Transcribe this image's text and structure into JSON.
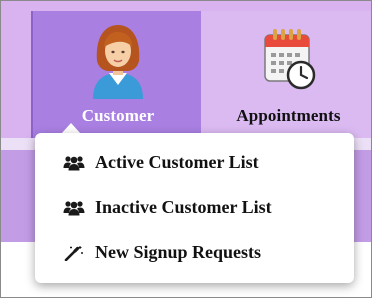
{
  "navbar": {
    "items": [
      {
        "label": "Customer",
        "icon": "customer-avatar-icon",
        "active": true
      },
      {
        "label": "Appointments",
        "icon": "calendar-clock-icon",
        "active": false
      }
    ]
  },
  "customer_menu": {
    "items": [
      {
        "label": "Active Customer List",
        "icon": "users-icon"
      },
      {
        "label": "Inactive Customer List",
        "icon": "users-icon"
      },
      {
        "label": "New Signup Requests",
        "icon": "magic-wand-icon"
      }
    ]
  },
  "colors": {
    "navbar_bg": "#d8b3f0",
    "active_tab_bg": "#a97fe2",
    "band_purple": "#c39ce6"
  }
}
